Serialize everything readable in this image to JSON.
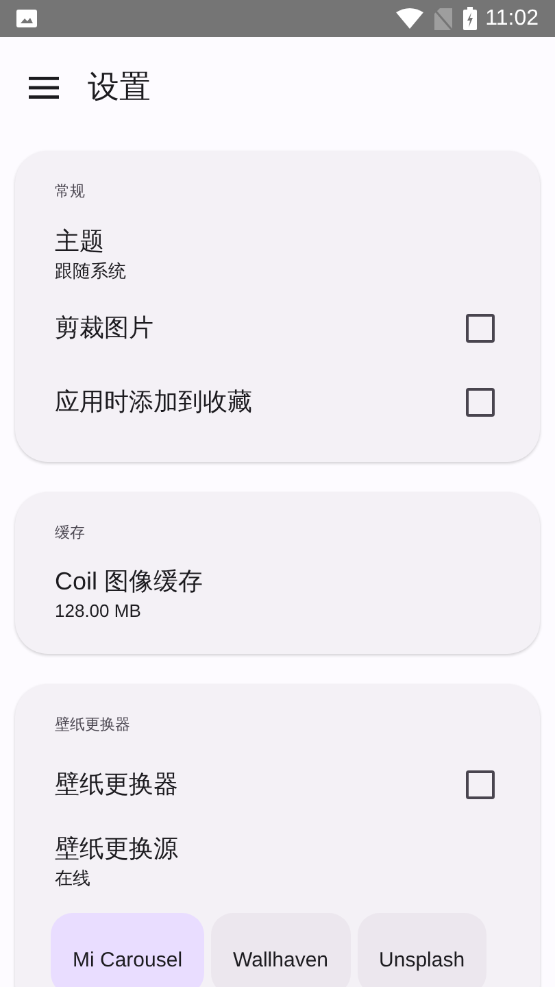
{
  "status_bar": {
    "time": "11:02"
  },
  "app_bar": {
    "title": "设置"
  },
  "sections": [
    {
      "header": "常规",
      "items": [
        {
          "kind": "text",
          "title": "主题",
          "value": "跟随系统"
        },
        {
          "kind": "checkbox",
          "title": "剪裁图片",
          "checked": false
        },
        {
          "kind": "checkbox",
          "title": "应用时添加到收藏",
          "checked": false
        }
      ]
    },
    {
      "header": "缓存",
      "items": [
        {
          "kind": "text",
          "title": "Coil 图像缓存",
          "value": "128.00 MB"
        }
      ]
    },
    {
      "header": "壁纸更换器",
      "items": [
        {
          "kind": "checkbox",
          "title": "壁纸更换器",
          "checked": false
        },
        {
          "kind": "text",
          "title": "壁纸更换源",
          "value": "在线"
        },
        {
          "kind": "chips",
          "options": [
            {
              "label": "Mi Carousel",
              "selected": true
            },
            {
              "label": "Wallhaven",
              "selected": false
            },
            {
              "label": "Unsplash",
              "selected": false
            }
          ]
        }
      ]
    }
  ]
}
